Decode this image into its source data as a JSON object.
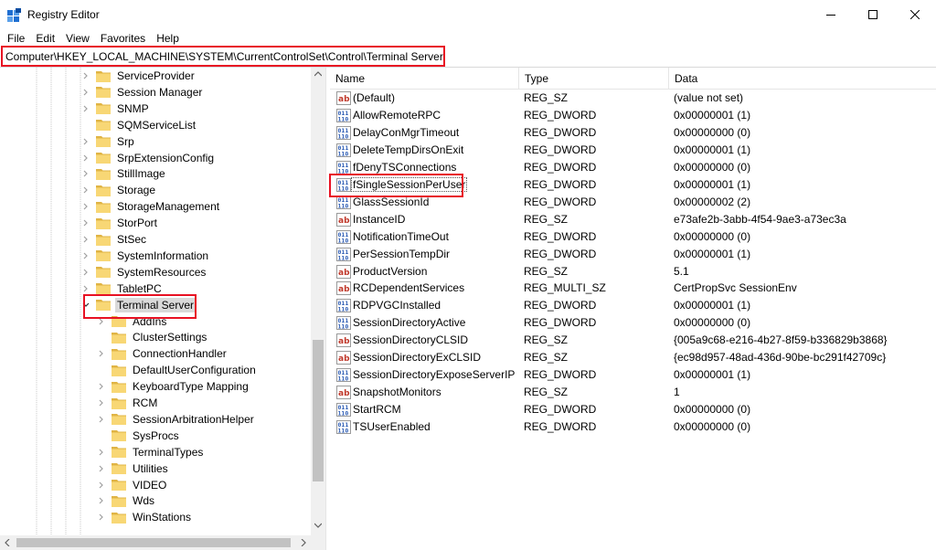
{
  "window": {
    "title": "Registry Editor",
    "icon": "registry-editor-icon"
  },
  "menu": [
    "File",
    "Edit",
    "View",
    "Favorites",
    "Help"
  ],
  "address": "Computer\\HKEY_LOCAL_MACHINE\\SYSTEM\\CurrentControlSet\\Control\\Terminal Server",
  "tree": {
    "items": [
      {
        "label": "ServiceProvider",
        "level": 1,
        "expander": "right"
      },
      {
        "label": "Session Manager",
        "level": 1,
        "expander": "right"
      },
      {
        "label": "SNMP",
        "level": 1,
        "expander": "right"
      },
      {
        "label": "SQMServiceList",
        "level": 1,
        "expander": "none"
      },
      {
        "label": "Srp",
        "level": 1,
        "expander": "right"
      },
      {
        "label": "SrpExtensionConfig",
        "level": 1,
        "expander": "right"
      },
      {
        "label": "StillImage",
        "level": 1,
        "expander": "right"
      },
      {
        "label": "Storage",
        "level": 1,
        "expander": "right"
      },
      {
        "label": "StorageManagement",
        "level": 1,
        "expander": "right"
      },
      {
        "label": "StorPort",
        "level": 1,
        "expander": "right"
      },
      {
        "label": "StSec",
        "level": 1,
        "expander": "right"
      },
      {
        "label": "SystemInformation",
        "level": 1,
        "expander": "right"
      },
      {
        "label": "SystemResources",
        "level": 1,
        "expander": "right"
      },
      {
        "label": "TabletPC",
        "level": 1,
        "expander": "right"
      },
      {
        "label": "Terminal Server",
        "level": 1,
        "expander": "down",
        "selected": true
      },
      {
        "label": "AddIns",
        "level": 2,
        "expander": "right"
      },
      {
        "label": "ClusterSettings",
        "level": 2,
        "expander": "none"
      },
      {
        "label": "ConnectionHandler",
        "level": 2,
        "expander": "right"
      },
      {
        "label": "DefaultUserConfiguration",
        "level": 2,
        "expander": "none"
      },
      {
        "label": "KeyboardType Mapping",
        "level": 2,
        "expander": "right"
      },
      {
        "label": "RCM",
        "level": 2,
        "expander": "right"
      },
      {
        "label": "SessionArbitrationHelper",
        "level": 2,
        "expander": "right"
      },
      {
        "label": "SysProcs",
        "level": 2,
        "expander": "none"
      },
      {
        "label": "TerminalTypes",
        "level": 2,
        "expander": "right"
      },
      {
        "label": "Utilities",
        "level": 2,
        "expander": "right"
      },
      {
        "label": "VIDEO",
        "level": 2,
        "expander": "right"
      },
      {
        "label": "Wds",
        "level": 2,
        "expander": "right"
      },
      {
        "label": "WinStations",
        "level": 2,
        "expander": "right"
      }
    ]
  },
  "list": {
    "columns": [
      "Name",
      "Type",
      "Data"
    ],
    "rows": [
      {
        "name": "(Default)",
        "type": "REG_SZ",
        "data": "(value not set)",
        "icon": "string-value-icon"
      },
      {
        "name": "AllowRemoteRPC",
        "type": "REG_DWORD",
        "data": "0x00000001 (1)",
        "icon": "binary-value-icon"
      },
      {
        "name": "DelayConMgrTimeout",
        "type": "REG_DWORD",
        "data": "0x00000000 (0)",
        "icon": "binary-value-icon"
      },
      {
        "name": "DeleteTempDirsOnExit",
        "type": "REG_DWORD",
        "data": "0x00000001 (1)",
        "icon": "binary-value-icon"
      },
      {
        "name": "fDenyTSConnections",
        "type": "REG_DWORD",
        "data": "0x00000000 (0)",
        "icon": "binary-value-icon"
      },
      {
        "name": "fSingleSessionPerUser",
        "type": "REG_DWORD",
        "data": "0x00000001 (1)",
        "icon": "binary-value-icon",
        "selected": true
      },
      {
        "name": "GlassSessionId",
        "type": "REG_DWORD",
        "data": "0x00000002 (2)",
        "icon": "binary-value-icon"
      },
      {
        "name": "InstanceID",
        "type": "REG_SZ",
        "data": "e73afe2b-3abb-4f54-9ae3-a73ec3a",
        "icon": "string-value-icon"
      },
      {
        "name": "NotificationTimeOut",
        "type": "REG_DWORD",
        "data": "0x00000000 (0)",
        "icon": "binary-value-icon"
      },
      {
        "name": "PerSessionTempDir",
        "type": "REG_DWORD",
        "data": "0x00000001 (1)",
        "icon": "binary-value-icon"
      },
      {
        "name": "ProductVersion",
        "type": "REG_SZ",
        "data": "5.1",
        "icon": "string-value-icon"
      },
      {
        "name": "RCDependentServices",
        "type": "REG_MULTI_SZ",
        "data": "CertPropSvc SessionEnv",
        "icon": "string-value-icon"
      },
      {
        "name": "RDPVGCInstalled",
        "type": "REG_DWORD",
        "data": "0x00000001 (1)",
        "icon": "binary-value-icon"
      },
      {
        "name": "SessionDirectoryActive",
        "type": "REG_DWORD",
        "data": "0x00000000 (0)",
        "icon": "binary-value-icon"
      },
      {
        "name": "SessionDirectoryCLSID",
        "type": "REG_SZ",
        "data": "{005a9c68-e216-4b27-8f59-b336829b3868}",
        "icon": "string-value-icon"
      },
      {
        "name": "SessionDirectoryExCLSID",
        "type": "REG_SZ",
        "data": "{ec98d957-48ad-436d-90be-bc291f42709c}",
        "icon": "string-value-icon"
      },
      {
        "name": "SessionDirectoryExposeServerIP",
        "type": "REG_DWORD",
        "data": "0x00000001 (1)",
        "icon": "binary-value-icon"
      },
      {
        "name": "SnapshotMonitors",
        "type": "REG_SZ",
        "data": "1",
        "icon": "string-value-icon"
      },
      {
        "name": "StartRCM",
        "type": "REG_DWORD",
        "data": "0x00000000 (0)",
        "icon": "binary-value-icon"
      },
      {
        "name": "TSUserEnabled",
        "type": "REG_DWORD",
        "data": "0x00000000 (0)",
        "icon": "binary-value-icon"
      }
    ]
  },
  "colors": {
    "highlight": "#e81123",
    "folder": "#f8d775",
    "folder_dark": "#e0b445",
    "string_icon": "#c0392b",
    "binary_icon": "#2f5eb5"
  }
}
